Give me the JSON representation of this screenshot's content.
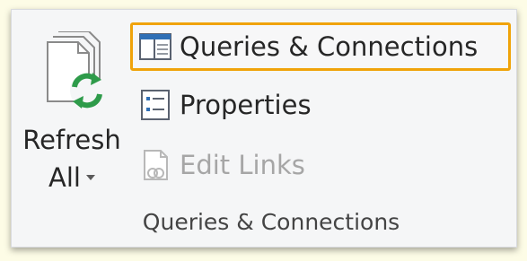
{
  "refresh_all": {
    "label_line1": "Refresh",
    "label_line2": "All",
    "icon": "refresh-all-icon"
  },
  "buttons": {
    "queries_connections": {
      "label": "Queries & Connections",
      "icon": "queries-connections-icon",
      "highlighted": true
    },
    "properties": {
      "label": "Properties",
      "icon": "properties-icon"
    },
    "edit_links": {
      "label": "Edit Links",
      "icon": "edit-links-icon",
      "disabled": true
    }
  },
  "group": {
    "label": "Queries & Connections"
  },
  "colors": {
    "highlight": "#f0a30a",
    "background": "#fdfce6",
    "ribbon": "#f5f6f7",
    "disabled_text": "#a6a6a6",
    "refresh_green": "#2e9b4a"
  }
}
